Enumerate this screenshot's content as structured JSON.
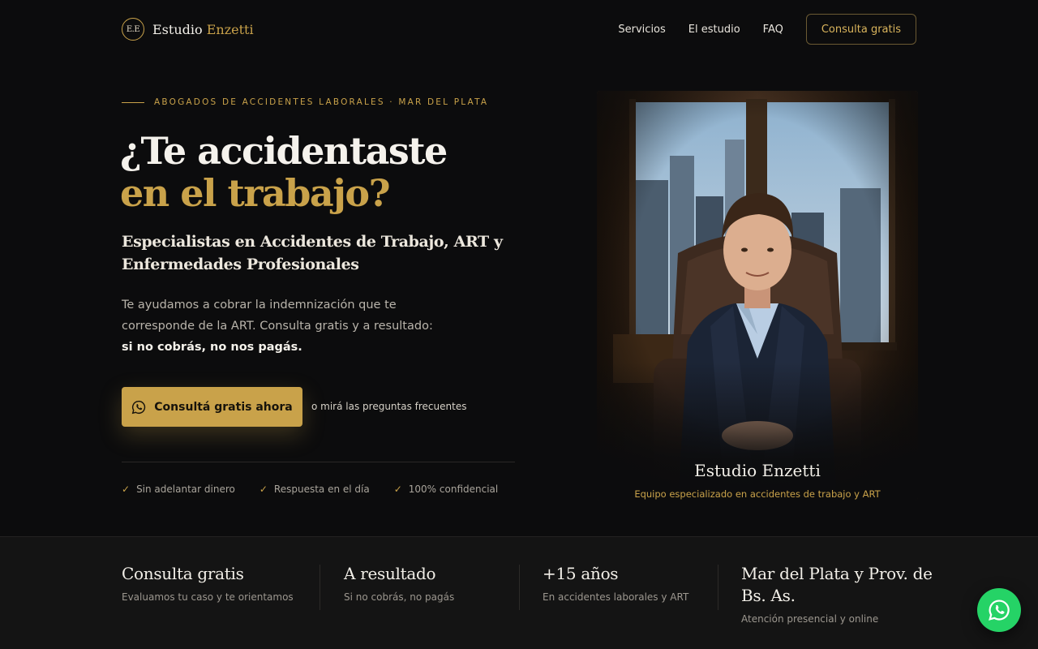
{
  "nav": {
    "logo_monogram": "E.E",
    "brand_first": "Estudio",
    "brand_second": "Enzetti",
    "links": [
      "Servicios",
      "El estudio",
      "FAQ"
    ],
    "cta_label": "Consulta gratis"
  },
  "hero": {
    "eyebrow": "ABOGADOS DE ACCIDENTES LABORALES · MAR DEL PLATA",
    "title_line1": "¿Te accidentaste",
    "title_line2": "en el trabajo?",
    "subtitle": "Especialistas en Accidentes de Trabajo, ART y Enfermedades Profesionales",
    "description": "Te ayudamos a cobrar la indemnización que te corresponde de la ART. Consulta gratis y a resultado: ",
    "description_strong": "si no cobrás, no nos pagás.",
    "cta_label": "Consultá gratis ahora",
    "cta_icon": "whatsapp-icon",
    "alt_link": "o mirá las preguntas frecuentes",
    "checks": [
      "Sin adelantar dinero",
      "Respuesta en el día",
      "100% confidencial"
    ],
    "photo_title": "Estudio Enzetti",
    "photo_subtitle": "Equipo especializado en accidentes de trabajo y ART"
  },
  "stats": [
    {
      "title": "Consulta gratis",
      "subtitle": "Evaluamos tu caso y te orientamos"
    },
    {
      "title": "A resultado",
      "subtitle": "Si no cobrás, no pagás"
    },
    {
      "title": "+15 años",
      "subtitle": "En accidentes laborales y ART"
    },
    {
      "title": "Mar del Plata y Prov. de Bs. As.",
      "subtitle": "Atención presencial y online"
    }
  ],
  "colors": {
    "background": "#0c0c0d",
    "accent_gold": "#c9a24a",
    "whatsapp_green": "#25d366"
  }
}
